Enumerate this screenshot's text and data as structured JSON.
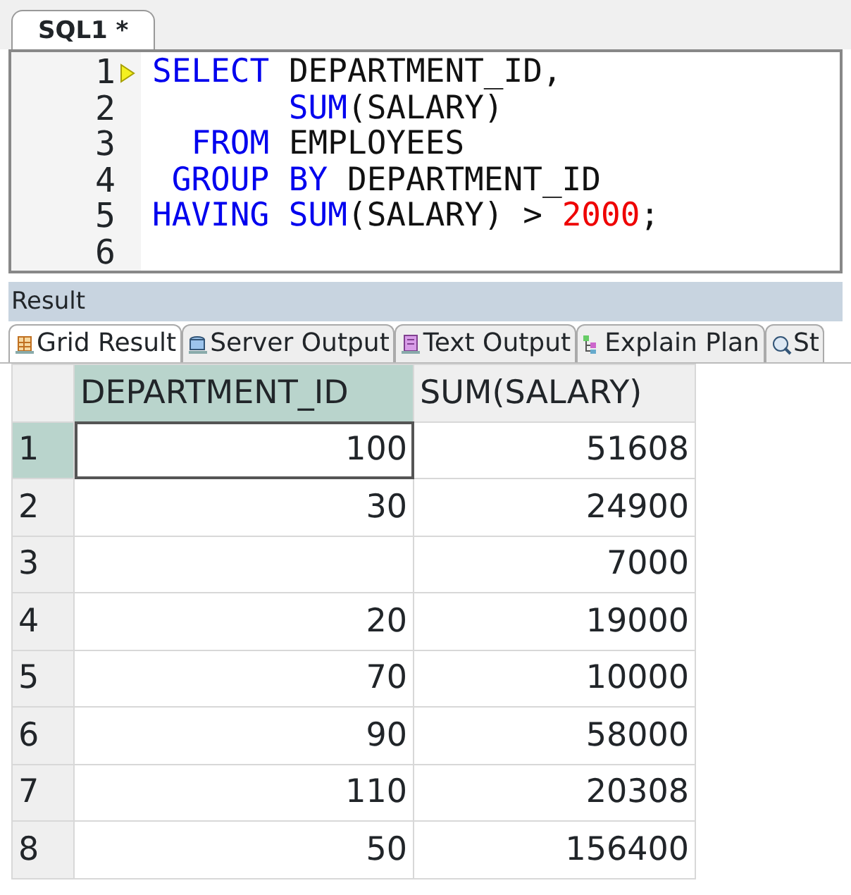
{
  "editor_tabs": [
    {
      "label": "SQL1 *",
      "selected": true
    }
  ],
  "editor": {
    "lines": [
      {
        "number": "1",
        "current": true,
        "tokens": [
          {
            "kind": "keyword",
            "text": "SELECT"
          },
          {
            "kind": "plain",
            "text": " DEPARTMENT_ID,"
          }
        ]
      },
      {
        "number": "2",
        "current": false,
        "tokens": [
          {
            "kind": "keyword",
            "text": "       SUM"
          },
          {
            "kind": "plain",
            "text": "(SALARY)"
          }
        ]
      },
      {
        "number": "3",
        "current": false,
        "tokens": [
          {
            "kind": "keyword",
            "text": "  FROM"
          },
          {
            "kind": "plain",
            "text": " EMPLOYEES"
          }
        ]
      },
      {
        "number": "4",
        "current": false,
        "tokens": [
          {
            "kind": "keyword",
            "text": " GROUP BY"
          },
          {
            "kind": "plain",
            "text": " DEPARTMENT_ID"
          }
        ]
      },
      {
        "number": "5",
        "current": false,
        "tokens": [
          {
            "kind": "keyword",
            "text": "HAVING SUM"
          },
          {
            "kind": "plain",
            "text": "(SALARY) > "
          },
          {
            "kind": "number",
            "text": "2000"
          },
          {
            "kind": "plain",
            "text": ";"
          }
        ]
      },
      {
        "number": "6",
        "current": false
      }
    ]
  },
  "result_panel": {
    "title": "Result"
  },
  "result_tabs": [
    {
      "label": "Grid Result",
      "kind": "grid",
      "selected": true
    },
    {
      "label": "Server Output",
      "kind": "server",
      "selected": false
    },
    {
      "label": "Text Output",
      "kind": "text",
      "selected": false
    },
    {
      "label": "Explain Plan",
      "kind": "plan",
      "selected": false
    },
    {
      "label": "St",
      "kind": "search",
      "selected": false
    }
  ],
  "grid": {
    "columns": [
      {
        "label": "DEPARTMENT_ID",
        "selected": true
      },
      {
        "label": "SUM(SALARY)",
        "selected": false
      }
    ],
    "rows": [
      {
        "number": "1",
        "selected": true,
        "cells": [
          "100",
          "51608"
        ]
      },
      {
        "number": "2",
        "selected": false,
        "cells": [
          "30",
          "24900"
        ]
      },
      {
        "number": "3",
        "selected": false,
        "cells": [
          "",
          "7000"
        ]
      },
      {
        "number": "4",
        "selected": false,
        "cells": [
          "20",
          "19000"
        ]
      },
      {
        "number": "5",
        "selected": false,
        "cells": [
          "70",
          "10000"
        ]
      },
      {
        "number": "6",
        "selected": false,
        "cells": [
          "90",
          "58000"
        ]
      },
      {
        "number": "7",
        "selected": false,
        "cells": [
          "110",
          "20308"
        ]
      },
      {
        "number": "8",
        "selected": false,
        "cells": [
          "50",
          "156400"
        ]
      }
    ]
  }
}
